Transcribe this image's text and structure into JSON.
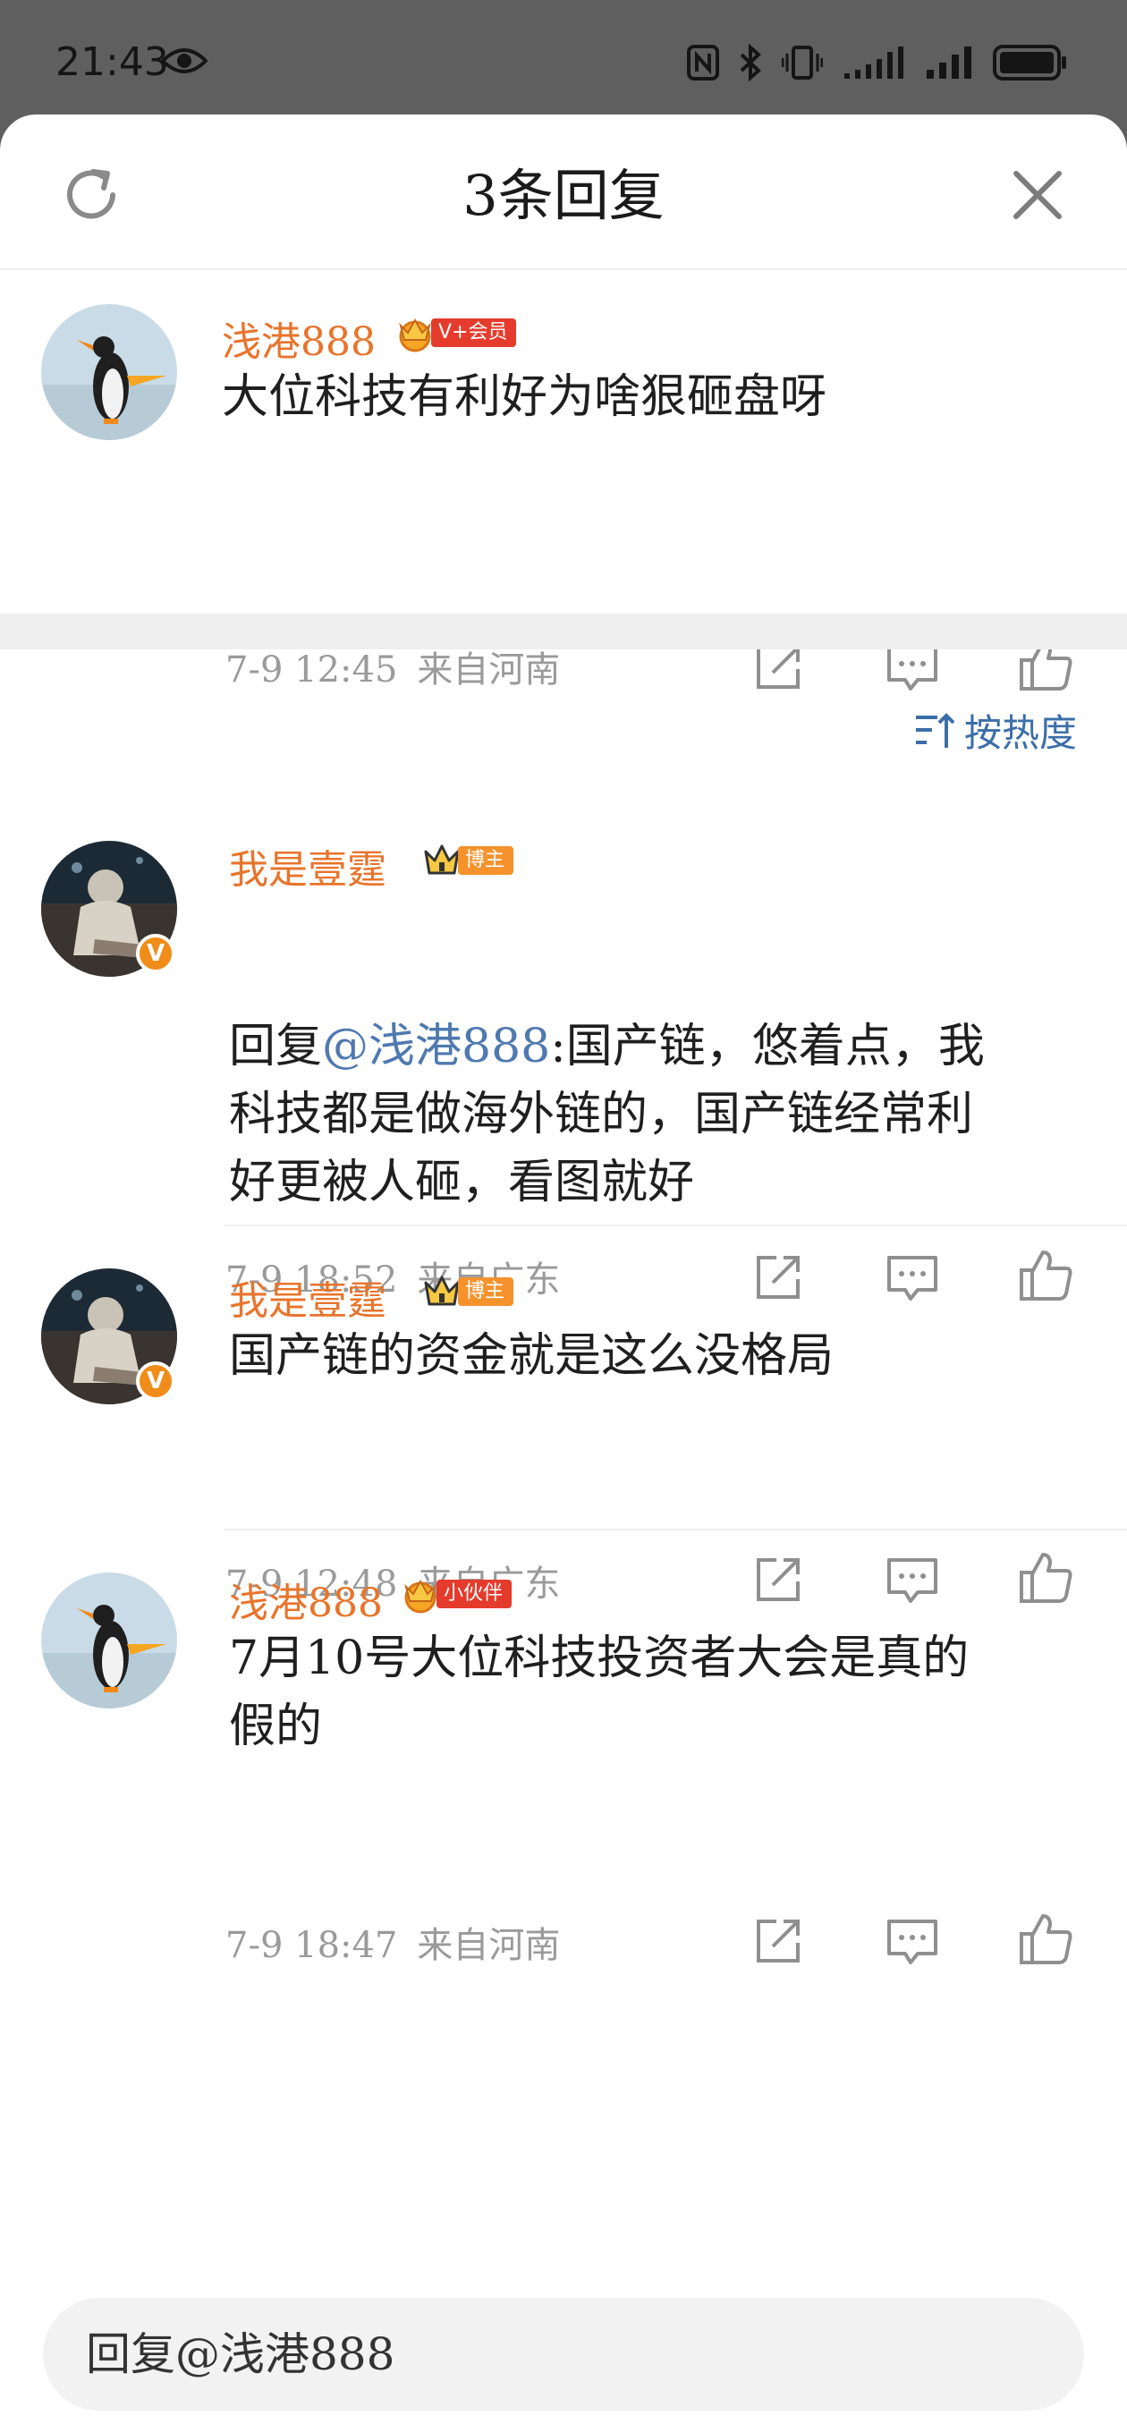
{
  "status_bar": {
    "time": "21:43",
    "icons": [
      "eye-icon",
      "nfc-icon",
      "bluetooth-icon",
      "vibrate-icon",
      "signal-icon",
      "signal-icon",
      "battery-icon"
    ]
  },
  "sheet": {
    "title": "3条回复",
    "refresh_icon": "refresh-icon",
    "close_icon": "close-icon"
  },
  "root_comment": {
    "username": "浅港888",
    "badge": "V+会员",
    "content": "大位科技有利好为啥狠砸盘呀",
    "time": "7-9 12:45",
    "location": "来自河南"
  },
  "sort": {
    "label": "按热度",
    "icon": "sort-icon"
  },
  "replies": [
    {
      "username": "我是壹霆",
      "badge": "博主",
      "content_prefix": "回复",
      "mention": "@浅港888",
      "content_line1_rest": ":国产链，悠着点，我",
      "content_line2": "科技都是做海外链的，国产链经常利",
      "content_line3": "好更被人砸，看图就好",
      "time": "7-9 18:52",
      "location": "来自广东"
    },
    {
      "username": "我是壹霆",
      "badge": "博主",
      "content": "国产链的资金就是这么没格局",
      "time": "7-9 12:48",
      "location": "来自广东"
    },
    {
      "username": "浅港888",
      "badge": "小伙伴",
      "content_line1": "7月10号大位科技投资者大会是真的",
      "content_line2": "假的",
      "time": "7-9 18:47",
      "location": "来自河南"
    }
  ],
  "reply_input": {
    "placeholder": "回复@浅港888"
  },
  "colors": {
    "username": "#e8742b",
    "mention": "#4f79b0",
    "meta": "#9a9a9a",
    "vip_tag": "#e53b2c",
    "blogger_tag": "#f5922c"
  }
}
